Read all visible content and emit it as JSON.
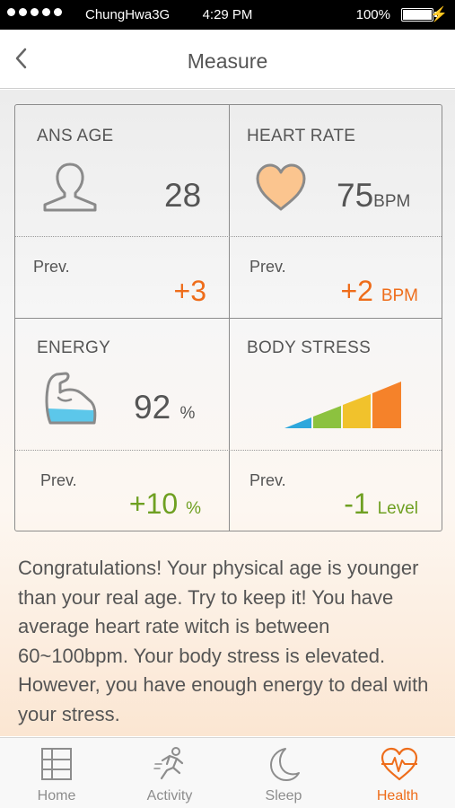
{
  "status_bar": {
    "carrier": "ChungHwa3G",
    "time": "4:29 PM",
    "battery": "100%"
  },
  "nav": {
    "title": "Measure",
    "back_icon": "chevron-left-icon"
  },
  "cards": {
    "ans_age": {
      "label": "ANS AGE",
      "icon": "person-icon",
      "value": "28",
      "prev_label": "Prev.",
      "prev_delta": "+3"
    },
    "heart_rate": {
      "label": "HEART RATE",
      "icon": "heart-icon",
      "value": "75",
      "unit": "BPM",
      "prev_label": "Prev.",
      "prev_delta": "+2",
      "prev_unit": "BPM"
    },
    "energy": {
      "label": "ENERGY",
      "icon": "muscle-arm-icon",
      "value": "92",
      "unit": "%",
      "prev_label": "Prev.",
      "prev_delta": "+10",
      "prev_unit": "%"
    },
    "body_stress": {
      "label": "BODY STRESS",
      "icon": "stress-level-bars-icon",
      "level_colors": [
        "#2ea7dc",
        "#8cc23f",
        "#f1c22c",
        "#f5822a"
      ],
      "active_levels": 4,
      "prev_label": "Prev.",
      "prev_delta": "-1",
      "prev_unit": "Level"
    }
  },
  "colors": {
    "accent_orange": "#ee6d1b",
    "accent_green": "#6fa022",
    "heart_fill": "#fbc58f",
    "water_blue": "#5cc7ea"
  },
  "message": "Congratulations! Your physical age is younger than your real age. Try to keep it! You have average heart rate witch is between 60~100bpm. Your body stress is elevated. However, you have enough energy to deal with your stress.",
  "tabs": [
    {
      "label": "Home",
      "icon": "home-grid-icon",
      "active": false
    },
    {
      "label": "Activity",
      "icon": "runner-icon",
      "active": false
    },
    {
      "label": "Sleep",
      "icon": "moon-icon",
      "active": false
    },
    {
      "label": "Health",
      "icon": "heart-pulse-icon",
      "active": true
    }
  ]
}
